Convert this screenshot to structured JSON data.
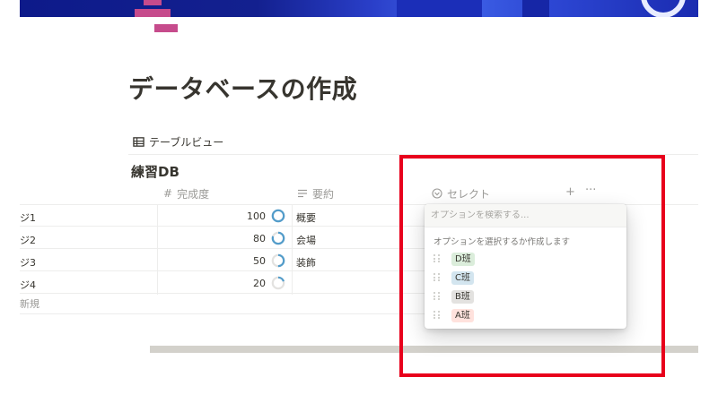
{
  "page": {
    "title": "データベースの作成"
  },
  "view": {
    "tab_label": "テーブルビュー",
    "db_title": "練習DB"
  },
  "table": {
    "columns": [
      {
        "label": "完成度",
        "icon": "hash-icon"
      },
      {
        "label": "要約",
        "icon": "text-lines-icon"
      },
      {
        "label": "セレクト",
        "icon": "select-chevron-icon"
      }
    ],
    "add_column": "+",
    "more": "···",
    "rows": [
      {
        "name": "ジ1",
        "progress": "100",
        "progress_value": 100,
        "summary": "概要"
      },
      {
        "name": "ジ2",
        "progress": "80",
        "progress_value": 80,
        "summary": "会場"
      },
      {
        "name": "ジ3",
        "progress": "50",
        "progress_value": 50,
        "summary": "装飾"
      },
      {
        "name": "ジ4",
        "progress": "20",
        "progress_value": 20,
        "summary": ""
      }
    ],
    "new_row": "新規"
  },
  "dropdown": {
    "search_placeholder": "オプションを検索する...",
    "hint": "オプションを選択するか作成します",
    "options": [
      {
        "label": "D班",
        "color": "#dbeddb"
      },
      {
        "label": "C班",
        "color": "#d3e5ef"
      },
      {
        "label": "B班",
        "color": "#e3e2e0"
      },
      {
        "label": "A班",
        "color": "#ffe2dd"
      }
    ]
  },
  "colors": {
    "highlight": "#e8001c",
    "cover": "#13208f",
    "icon_accent": "#c64b8c",
    "ring": "#529cca"
  }
}
